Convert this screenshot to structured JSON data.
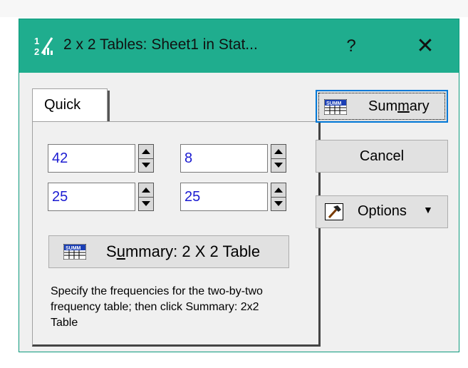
{
  "window": {
    "title": "2 x 2 Tables: Sheet1 in Stat...",
    "help_label": "?",
    "close_label": "✕"
  },
  "tabs": [
    {
      "label": "Quick"
    }
  ],
  "cells": {
    "r1c1": "42",
    "r1c2": "8",
    "r2c1": "25",
    "r2c2": "25"
  },
  "table_button": {
    "label_pre": "S",
    "label_u": "u",
    "label_post": "mmary:  2 X 2 Table"
  },
  "hint": "Specify the frequencies for the two-by-two frequency table; then click Summary: 2x2 Table",
  "buttons": {
    "summary": {
      "pre": "Sum",
      "u": "m",
      "post": "ary"
    },
    "cancel": "Cancel",
    "options": "Options",
    "options_arrow": "▼"
  },
  "icons": {
    "app": "stat-app-icon",
    "summary": "summ-table-icon",
    "options": "hammer-icon"
  },
  "colors": {
    "titlebar": "#1fad8e",
    "value_text": "#1b1bd1",
    "focus": "#0078d7"
  }
}
